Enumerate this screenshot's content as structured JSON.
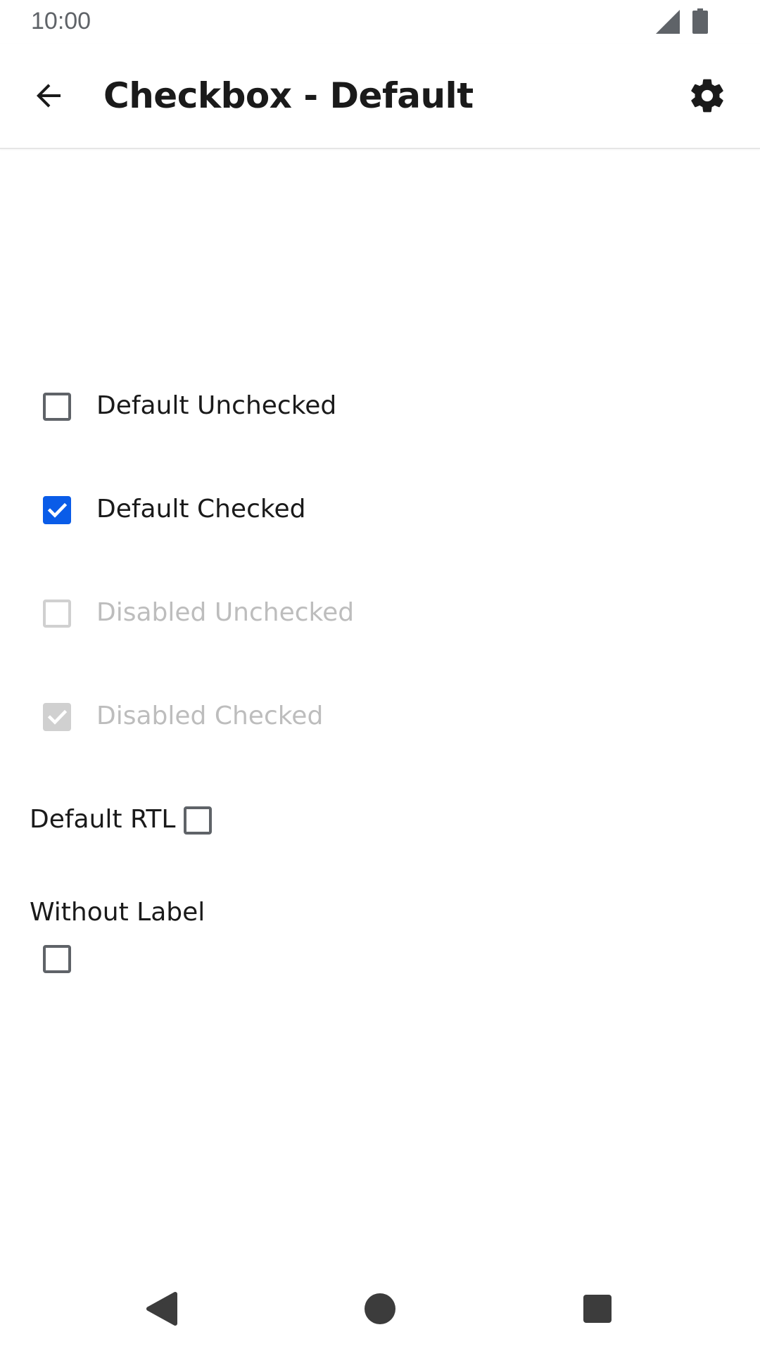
{
  "status_bar": {
    "time": "10:00",
    "signal_icon": "cellular-signal-icon",
    "battery_icon": "battery-icon"
  },
  "app_bar": {
    "title": "Checkbox - Default",
    "back_icon": "arrow-back-icon",
    "settings_icon": "gear-icon"
  },
  "checkboxes": [
    {
      "label": "Default Unchecked",
      "checked": false,
      "disabled": false
    },
    {
      "label": "Default Checked",
      "checked": true,
      "disabled": false
    },
    {
      "label": "Disabled Unchecked",
      "checked": false,
      "disabled": true
    },
    {
      "label": "Disabled Checked",
      "checked": true,
      "disabled": true
    },
    {
      "label": "Default RTL",
      "checked": false,
      "disabled": false
    },
    {
      "label": "",
      "checked": false,
      "disabled": false
    }
  ],
  "without_label_heading": "Without Label",
  "nav_bar": {
    "back_icon": "nav-back-icon",
    "home_icon": "nav-home-icon",
    "recents_icon": "nav-recents-icon"
  },
  "colors": {
    "accent": "#0a5ce8",
    "unchecked_border": "#5f6368",
    "disabled": "#d0d0d0",
    "disabled_text": "#bdbdbd",
    "text": "#1a1a1a"
  }
}
